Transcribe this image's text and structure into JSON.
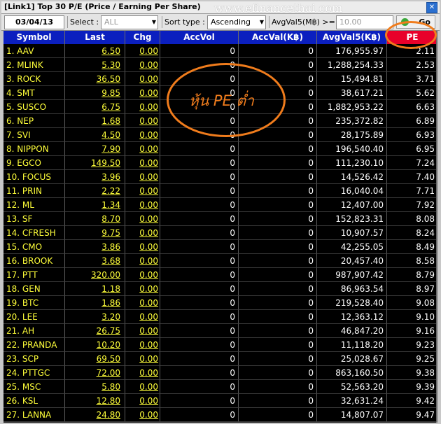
{
  "window": {
    "title": "[Link1] Top 30 P/E (Price / Earning Per Share)",
    "watermark": "www.efinancethai.com"
  },
  "toolbar": {
    "date": "03/04/13",
    "select_label": "Select :",
    "select_value": "ALL",
    "sort_label": "Sort type :",
    "sort_value": "Ascending",
    "avgval_label": "AvgVal5(M฿) >=",
    "avgval_value": "10.00",
    "go_label": "Go"
  },
  "table": {
    "columns": [
      "Symbol",
      "Last",
      "Chg",
      "AccVol",
      "AccVal(K฿)",
      "AvgVal5(K฿)",
      "PE"
    ],
    "rows": [
      {
        "symbol": "1. AAV",
        "last": "6.50",
        "chg": "0.00",
        "accvol": "0",
        "accval": "0",
        "avgval5": "176,955.97",
        "pe": "2.11"
      },
      {
        "symbol": "2. MLINK",
        "last": "5.30",
        "chg": "0.00",
        "accvol": "0",
        "accval": "0",
        "avgval5": "1,288,254.33",
        "pe": "2.53"
      },
      {
        "symbol": "3. ROCK",
        "last": "36.50",
        "chg": "0.00",
        "accvol": "0",
        "accval": "0",
        "avgval5": "15,494.81",
        "pe": "3.71"
      },
      {
        "symbol": "4. SMT",
        "last": "9.85",
        "chg": "0.00",
        "accvol": "0",
        "accval": "0",
        "avgval5": "38,617.21",
        "pe": "5.62"
      },
      {
        "symbol": "5. SUSCO",
        "last": "6.75",
        "chg": "0.00",
        "accvol": "0",
        "accval": "0",
        "avgval5": "1,882,953.22",
        "pe": "6.63"
      },
      {
        "symbol": "6. NEP",
        "last": "1.68",
        "chg": "0.00",
        "accvol": "0",
        "accval": "0",
        "avgval5": "235,372.82",
        "pe": "6.89"
      },
      {
        "symbol": "7. SVI",
        "last": "4.50",
        "chg": "0.00",
        "accvol": "0",
        "accval": "0",
        "avgval5": "28,175.89",
        "pe": "6.93"
      },
      {
        "symbol": "8. NIPPON",
        "last": "7.90",
        "chg": "0.00",
        "accvol": "0",
        "accval": "0",
        "avgval5": "196,540.40",
        "pe": "6.95"
      },
      {
        "symbol": "9. EGCO",
        "last": "149.50",
        "chg": "0.00",
        "accvol": "0",
        "accval": "0",
        "avgval5": "111,230.10",
        "pe": "7.24"
      },
      {
        "symbol": "10. FOCUS",
        "last": "3.96",
        "chg": "0.00",
        "accvol": "0",
        "accval": "0",
        "avgval5": "14,526.42",
        "pe": "7.40"
      },
      {
        "symbol": "11. PRIN",
        "last": "2.22",
        "chg": "0.00",
        "accvol": "0",
        "accval": "0",
        "avgval5": "16,040.04",
        "pe": "7.71"
      },
      {
        "symbol": "12. ML",
        "last": "1.34",
        "chg": "0.00",
        "accvol": "0",
        "accval": "0",
        "avgval5": "12,407.00",
        "pe": "7.92"
      },
      {
        "symbol": "13. SF",
        "last": "8.70",
        "chg": "0.00",
        "accvol": "0",
        "accval": "0",
        "avgval5": "152,823.31",
        "pe": "8.08"
      },
      {
        "symbol": "14. CFRESH",
        "last": "9.75",
        "chg": "0.00",
        "accvol": "0",
        "accval": "0",
        "avgval5": "10,907.57",
        "pe": "8.24"
      },
      {
        "symbol": "15. CMO",
        "last": "3.86",
        "chg": "0.00",
        "accvol": "0",
        "accval": "0",
        "avgval5": "42,255.05",
        "pe": "8.49"
      },
      {
        "symbol": "16. BROOK",
        "last": "3.68",
        "chg": "0.00",
        "accvol": "0",
        "accval": "0",
        "avgval5": "20,457.40",
        "pe": "8.58"
      },
      {
        "symbol": "17. PTT",
        "last": "320.00",
        "chg": "0.00",
        "accvol": "0",
        "accval": "0",
        "avgval5": "987,907.42",
        "pe": "8.79"
      },
      {
        "symbol": "18. GEN",
        "last": "1.18",
        "chg": "0.00",
        "accvol": "0",
        "accval": "0",
        "avgval5": "86,963.54",
        "pe": "8.97"
      },
      {
        "symbol": "19. BTC",
        "last": "1.86",
        "chg": "0.00",
        "accvol": "0",
        "accval": "0",
        "avgval5": "219,528.40",
        "pe": "9.08"
      },
      {
        "symbol": "20. LEE",
        "last": "3.20",
        "chg": "0.00",
        "accvol": "0",
        "accval": "0",
        "avgval5": "12,363.12",
        "pe": "9.10"
      },
      {
        "symbol": "21. AH",
        "last": "26.75",
        "chg": "0.00",
        "accvol": "0",
        "accval": "0",
        "avgval5": "46,847.20",
        "pe": "9.16"
      },
      {
        "symbol": "22. PRANDA",
        "last": "10.20",
        "chg": "0.00",
        "accvol": "0",
        "accval": "0",
        "avgval5": "11,118.20",
        "pe": "9.23"
      },
      {
        "symbol": "23. SCP",
        "last": "69.50",
        "chg": "0.00",
        "accvol": "0",
        "accval": "0",
        "avgval5": "25,028.67",
        "pe": "9.25"
      },
      {
        "symbol": "24. PTTGC",
        "last": "72.00",
        "chg": "0.00",
        "accvol": "0",
        "accval": "0",
        "avgval5": "863,160.50",
        "pe": "9.38"
      },
      {
        "symbol": "25. MSC",
        "last": "5.80",
        "chg": "0.00",
        "accvol": "0",
        "accval": "0",
        "avgval5": "52,563.20",
        "pe": "9.39"
      },
      {
        "symbol": "26. KSL",
        "last": "12.80",
        "chg": "0.00",
        "accvol": "0",
        "accval": "0",
        "avgval5": "32,631.24",
        "pe": "9.42"
      },
      {
        "symbol": "27. LANNA",
        "last": "24.80",
        "chg": "0.00",
        "accvol": "0",
        "accval": "0",
        "avgval5": "14,807.07",
        "pe": "9.47"
      }
    ]
  },
  "annotation": {
    "text": "หุ้น PE ต่ำ",
    "color": "#f07c1c"
  },
  "colors": {
    "header_bg": "#0b1fbf",
    "pe_header_bg": "#e8002a",
    "grid_bg": "#000000",
    "symbol_text": "#ffff3a",
    "value_text": "#ffffff"
  }
}
